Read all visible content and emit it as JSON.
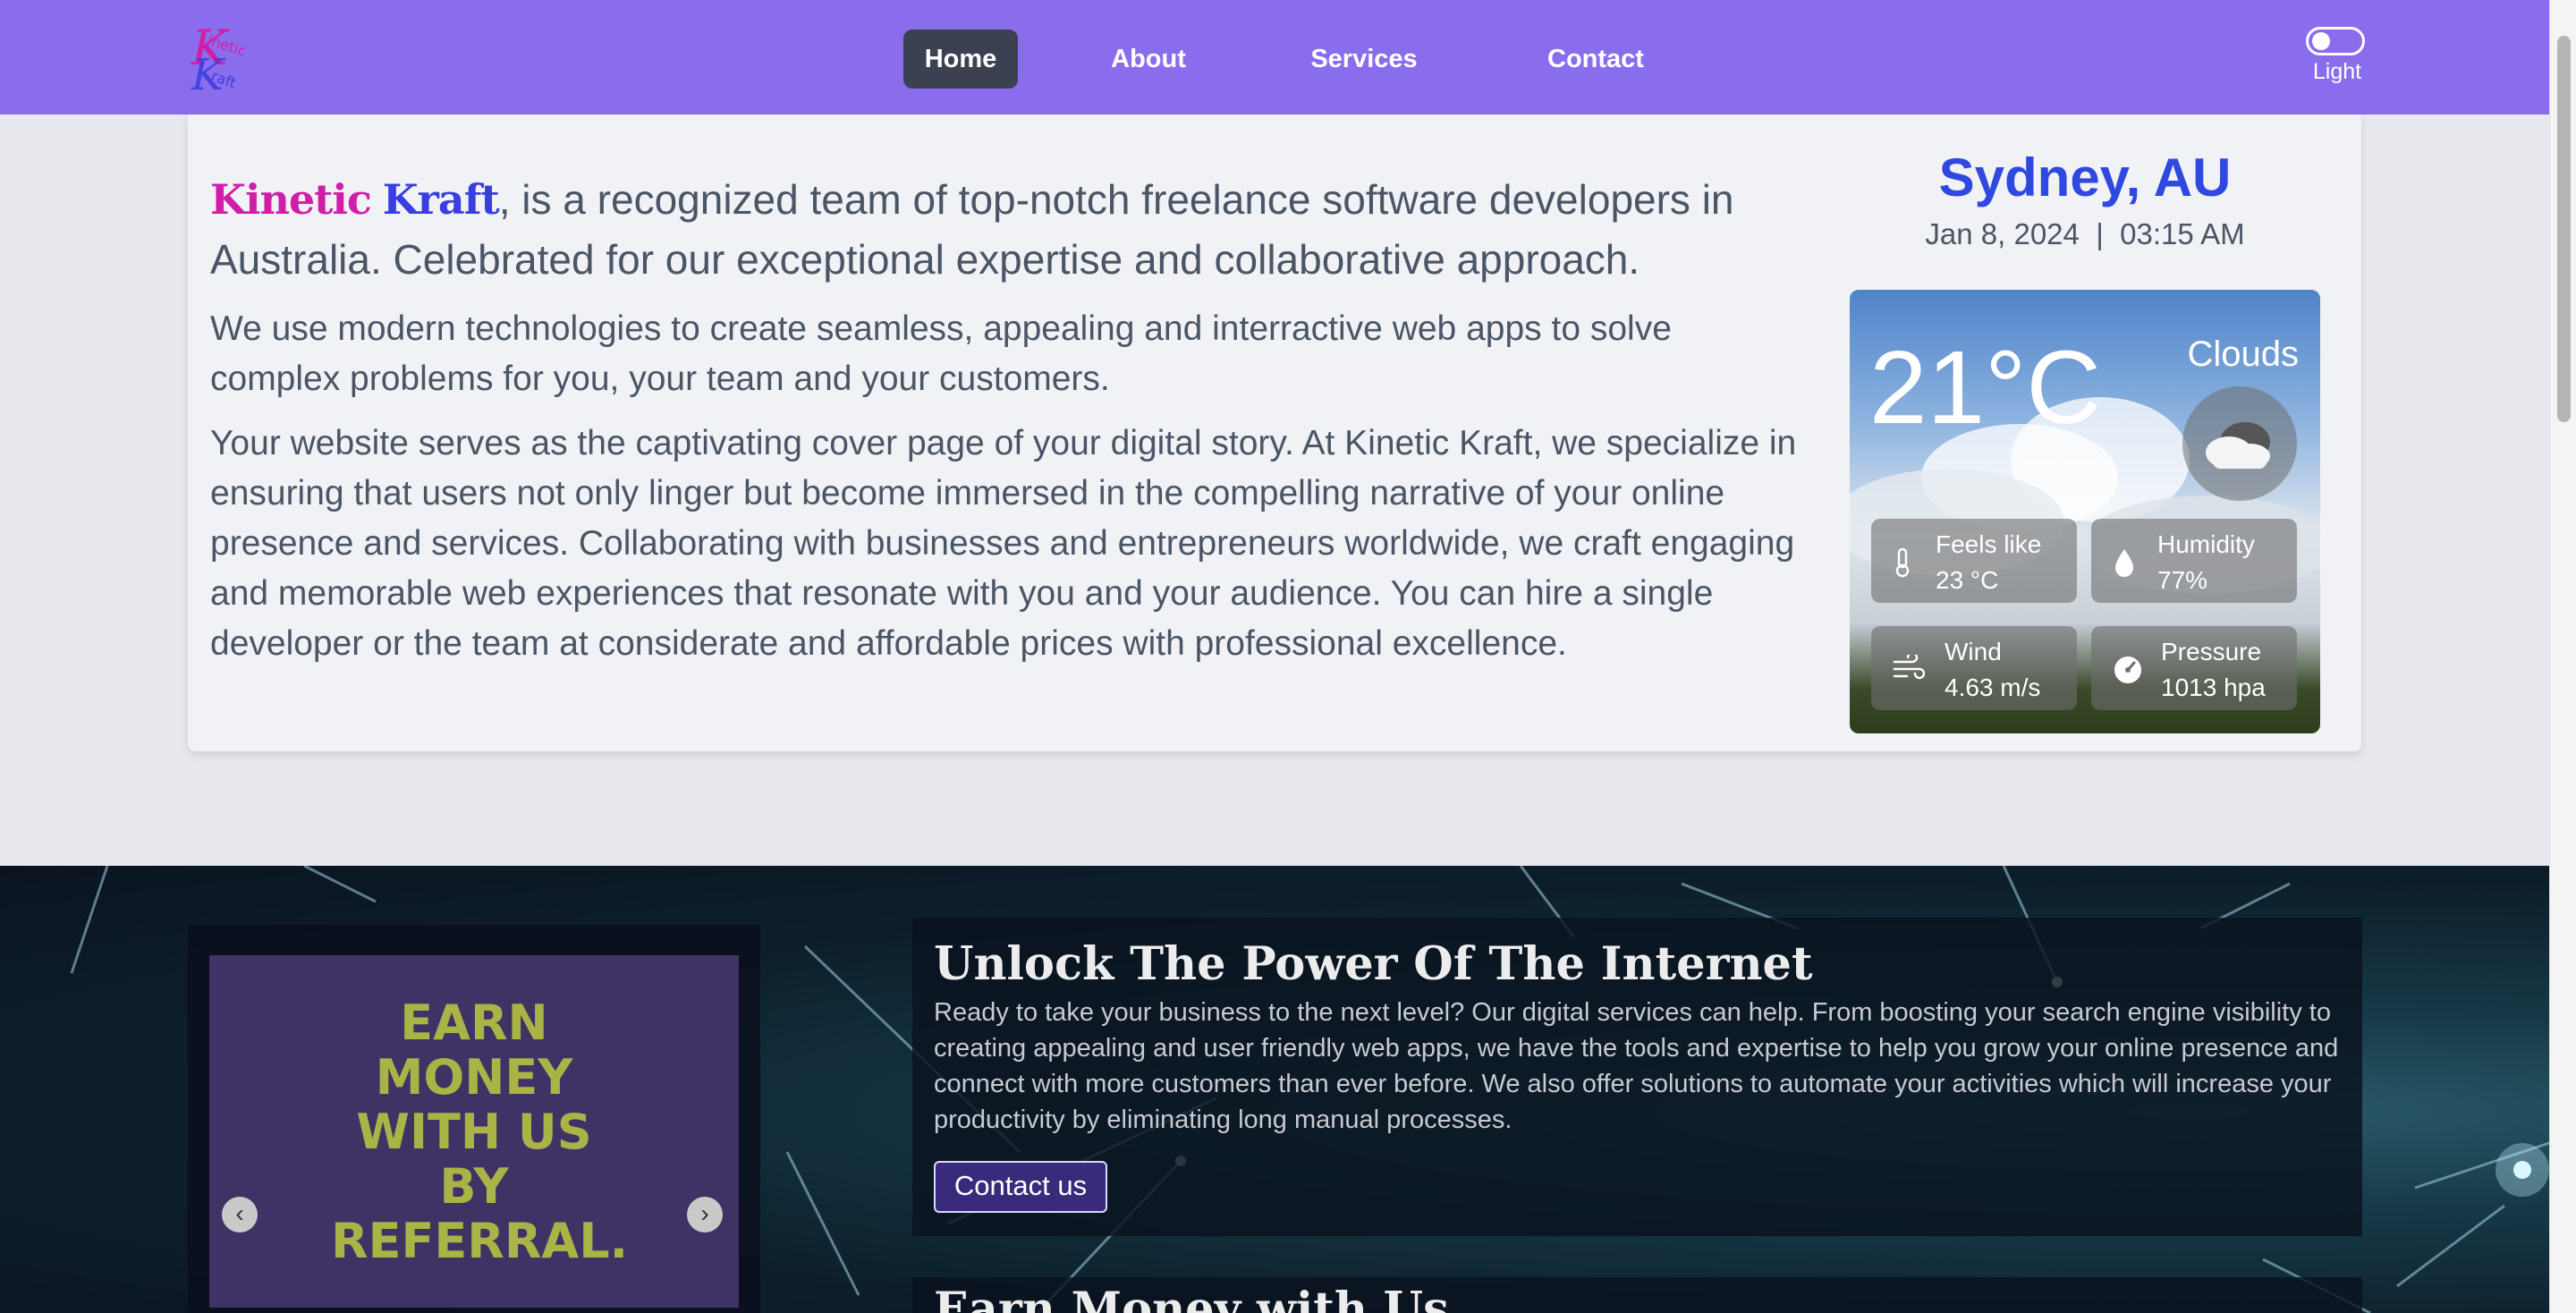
{
  "nav": {
    "links": [
      {
        "label": "Home",
        "active": true
      },
      {
        "label": "About",
        "active": false
      },
      {
        "label": "Services",
        "active": false
      },
      {
        "label": "Contact",
        "active": false
      }
    ],
    "theme_label": "Light",
    "logo_text_top": "Kinetic",
    "logo_text_bottom": "Kraft"
  },
  "intro": {
    "brand_part1": "Kinetic",
    "brand_part2": "Kraft",
    "lead_rest": ", is a recognized team of top-notch freelance software developers in Australia. Celebrated for our exceptional expertise and collaborative approach.",
    "para1": "We use modern technologies to create seamless, appealing and interractive web apps to solve complex problems for you, your team and your customers.",
    "para2": "Your website serves as the captivating cover page of your digital story. At Kinetic Kraft, we specialize in ensuring that users not only linger but become immersed in the compelling narrative of your online presence and services. Collaborating with businesses and entrepreneurs worldwide, we craft engaging and memorable web experiences that resonate with you and your audience. You can hire a single developer or the team at considerate and affordable prices with professional excellence."
  },
  "weather": {
    "city": "Sydney, AU",
    "date": "Jan 8, 2024",
    "separator": "|",
    "time": "03:15 AM",
    "temp": "21°C",
    "condition": "Clouds",
    "feels_like_label": "Feels like",
    "feels_like_value": "23 °C",
    "humidity_label": "Humidity",
    "humidity_value": "77%",
    "wind_label": "Wind",
    "wind_value": "4.63 m/s",
    "pressure_label": "Pressure",
    "pressure_value": "1013 hpa"
  },
  "promo": {
    "slide_text": "Earn money with us by referral.",
    "title": "Unlock The Power Of The Internet",
    "text": "Ready to take your business to the next level? Our digital services can help. From boosting your search engine visibility to creating appealing and user friendly web apps, we have the tools and expertise to help you grow your online presence and connect with more customers than ever before. We also offer solutions to automate your activities which will increase your productivity by eliminating long manual processes.",
    "cta": "Contact us",
    "next_title": "Earn Money with Us"
  },
  "colors": {
    "navbar": "#8a6ded",
    "brand_pink": "#d11ea8",
    "brand_blue": "#3a3de0",
    "city": "#2f48e0",
    "slide_bg": "#3f3265",
    "slide_text": "#a9b346"
  }
}
